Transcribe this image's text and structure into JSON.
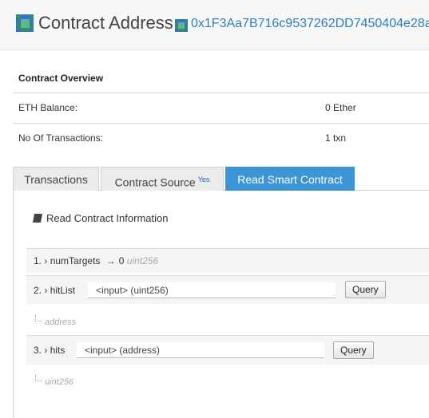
{
  "header": {
    "title": "Contract Address",
    "address": "0x1F3Aa7B716c9537262DD7450404e28a"
  },
  "overview": {
    "title": "Contract Overview",
    "eth_balance_label": "ETH Balance:",
    "eth_balance_value": "0 Ether",
    "txn_label": "No Of Transactions:",
    "txn_value": "1 txn"
  },
  "tabs": [
    {
      "label": "Transactions"
    },
    {
      "label": "Contract Source",
      "badge": "Yes"
    },
    {
      "label": "Read Smart Contract",
      "active": true
    }
  ],
  "read_contract": {
    "heading": "Read Contract Information",
    "items": [
      {
        "index": "1.",
        "name": "numTargets",
        "result": "0",
        "result_type": "uint256"
      },
      {
        "index": "2.",
        "name": "hitList",
        "input_placeholder": "<input> (uint256)",
        "button": "Query",
        "output_type": "address"
      },
      {
        "index": "3.",
        "name": "hits",
        "input_placeholder": "<input> (address)",
        "button": "Query",
        "output_type": "uint256"
      }
    ]
  },
  "icons": {
    "logo": "identicon-icon",
    "book": "book-icon",
    "chevron": "chevron-right-icon",
    "arrow": "arrow-right-icon"
  },
  "colors": {
    "accent": "#3b95d7",
    "link": "#2a7ec1",
    "badge": "#2a57d6"
  }
}
